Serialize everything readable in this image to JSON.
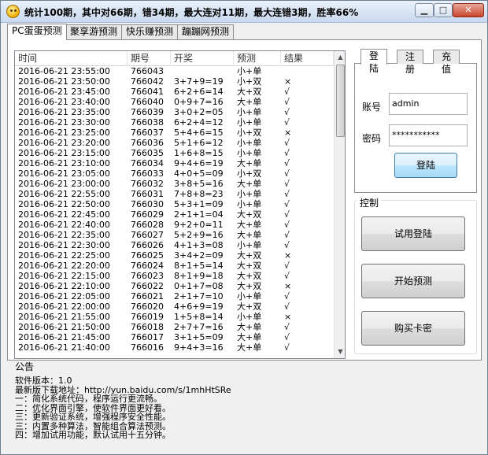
{
  "window": {
    "title": "统计100期，其中对66期，错34期，最大连对11期，最大连错3期，胜率66%",
    "min_glyph": "▁",
    "max_glyph": "□",
    "close_glyph": "✕",
    "icon": "smiley-icon"
  },
  "tabs": [
    "PC蛋蛋预测",
    "聚享游预测",
    "快乐赚预测",
    "蹦蹦网预测"
  ],
  "table": {
    "headers": [
      "时间",
      "期号",
      "开奖",
      "预测",
      "结果"
    ],
    "rows": [
      [
        "2016-06-21 23:55:00",
        "766043",
        "",
        "小+单",
        ""
      ],
      [
        "2016-06-21 23:50:00",
        "766042",
        "3+7+9=19",
        "小+双",
        "×"
      ],
      [
        "2016-06-21 23:45:00",
        "766041",
        "6+2+6=14",
        "大+双",
        "√"
      ],
      [
        "2016-06-21 23:40:00",
        "766040",
        "0+9+7=16",
        "大+单",
        "√"
      ],
      [
        "2016-06-21 23:35:00",
        "766039",
        "3+0+2=05",
        "小+单",
        "√"
      ],
      [
        "2016-06-21 23:30:00",
        "766038",
        "6+2+4=12",
        "小+单",
        "√"
      ],
      [
        "2016-06-21 23:25:00",
        "766037",
        "5+4+6=15",
        "小+双",
        "×"
      ],
      [
        "2016-06-21 23:20:00",
        "766036",
        "5+1+6=12",
        "小+单",
        "√"
      ],
      [
        "2016-06-21 23:15:00",
        "766035",
        "1+6+8=15",
        "小+单",
        "√"
      ],
      [
        "2016-06-21 23:10:00",
        "766034",
        "9+4+6=19",
        "大+单",
        "√"
      ],
      [
        "2016-06-21 23:05:00",
        "766033",
        "4+0+5=09",
        "小+双",
        "√"
      ],
      [
        "2016-06-21 23:00:00",
        "766032",
        "3+8+5=16",
        "大+单",
        "√"
      ],
      [
        "2016-06-21 22:55:00",
        "766031",
        "7+8+8=23",
        "小+单",
        "√"
      ],
      [
        "2016-06-21 22:50:00",
        "766030",
        "5+3+1=09",
        "小+单",
        "√"
      ],
      [
        "2016-06-21 22:45:00",
        "766029",
        "2+1+1=04",
        "大+双",
        "√"
      ],
      [
        "2016-06-21 22:40:00",
        "766028",
        "9+2+0=11",
        "大+单",
        "√"
      ],
      [
        "2016-06-21 22:35:00",
        "766027",
        "5+2+9=16",
        "大+单",
        "√"
      ],
      [
        "2016-06-21 22:30:00",
        "766026",
        "4+1+3=08",
        "小+单",
        "√"
      ],
      [
        "2016-06-21 22:25:00",
        "766025",
        "3+4+2=09",
        "大+双",
        "×"
      ],
      [
        "2016-06-21 22:20:00",
        "766024",
        "8+1+5=14",
        "大+双",
        "√"
      ],
      [
        "2016-06-21 22:15:00",
        "766023",
        "8+1+9=18",
        "大+双",
        "√"
      ],
      [
        "2016-06-21 22:10:00",
        "766022",
        "0+1+7=08",
        "大+双",
        "×"
      ],
      [
        "2016-06-21 22:05:00",
        "766021",
        "2+1+7=10",
        "小+单",
        "√"
      ],
      [
        "2016-06-21 22:00:00",
        "766020",
        "4+6+9=19",
        "大+双",
        "√"
      ],
      [
        "2016-06-21 21:55:00",
        "766019",
        "1+5+8=14",
        "小+单",
        "×"
      ],
      [
        "2016-06-21 21:50:00",
        "766018",
        "2+7+7=16",
        "大+单",
        "√"
      ],
      [
        "2016-06-21 21:45:00",
        "766017",
        "3+1+5=09",
        "大+单",
        "√"
      ],
      [
        "2016-06-21 21:40:00",
        "766016",
        "9+4+3=16",
        "大+单",
        "√"
      ]
    ]
  },
  "login": {
    "tabs": [
      "登陆",
      "注册",
      "充值"
    ],
    "account_label": "账号",
    "account_value": "admin",
    "password_label": "密码",
    "password_value": "***********",
    "login_button": "登陆"
  },
  "control": {
    "legend": "控制",
    "trial_login": "试用登陆",
    "start_predict": "开始预测",
    "buy_key": "购买卡密"
  },
  "notice": {
    "title": "公告",
    "lines": [
      "软件版本：1.0",
      "最新版下载地址：http://yun.baidu.com/s/1mhHtSRe",
      "一：简化系统代码，程序运行更流畅。",
      "二：优化界面引擎，使软件界面更好看。",
      "三：更新验证系统，增强程序安全性能。",
      "三：内置多种算法，智能组合算法预测。",
      "四：增加试用功能，默认试用十五分钟。"
    ]
  }
}
